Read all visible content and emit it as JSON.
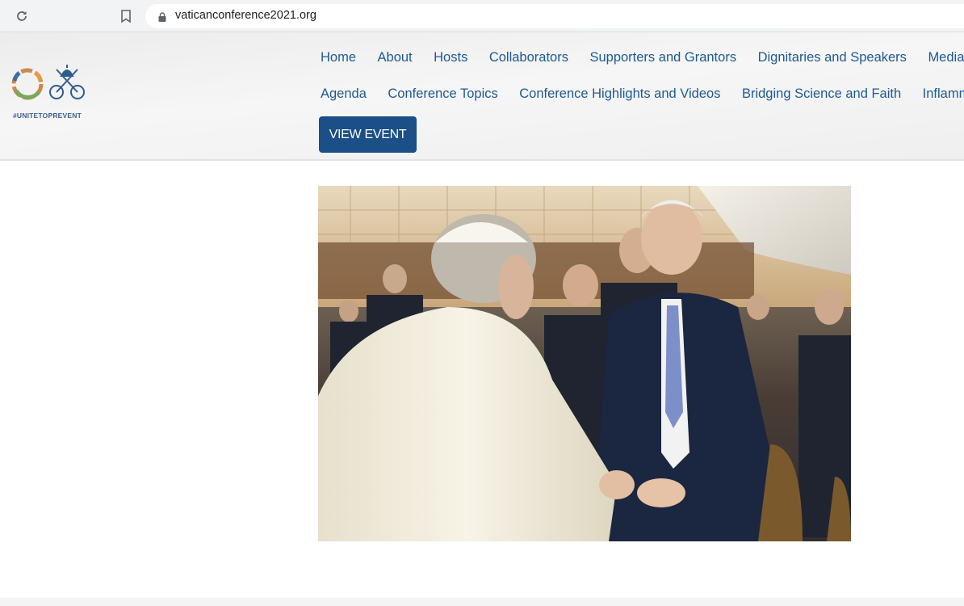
{
  "browser": {
    "url": "vaticanconference2021.org",
    "icons": {
      "reload": "reload-icon",
      "bookmark": "bookmark-icon",
      "lock": "lock-icon"
    }
  },
  "header": {
    "logo_tagline": "#UNITETOPREVENT",
    "nav_row_1": [
      "Home",
      "About",
      "Hosts",
      "Collaborators",
      "Supporters and Grantors",
      "Dignitaries and Speakers",
      "Media"
    ],
    "nav_row_2": [
      "Agenda",
      "Conference Topics",
      "Conference Highlights and Videos",
      "Bridging Science and Faith",
      "Inflammation"
    ],
    "cta_label": "VIEW EVENT",
    "colors": {
      "nav_link": "#1d5a93",
      "cta_bg": "#1a4f87"
    }
  },
  "main": {
    "photo_description": "Pope shaking hands with a smiling man in a navy suit in a crowded audience hall"
  }
}
